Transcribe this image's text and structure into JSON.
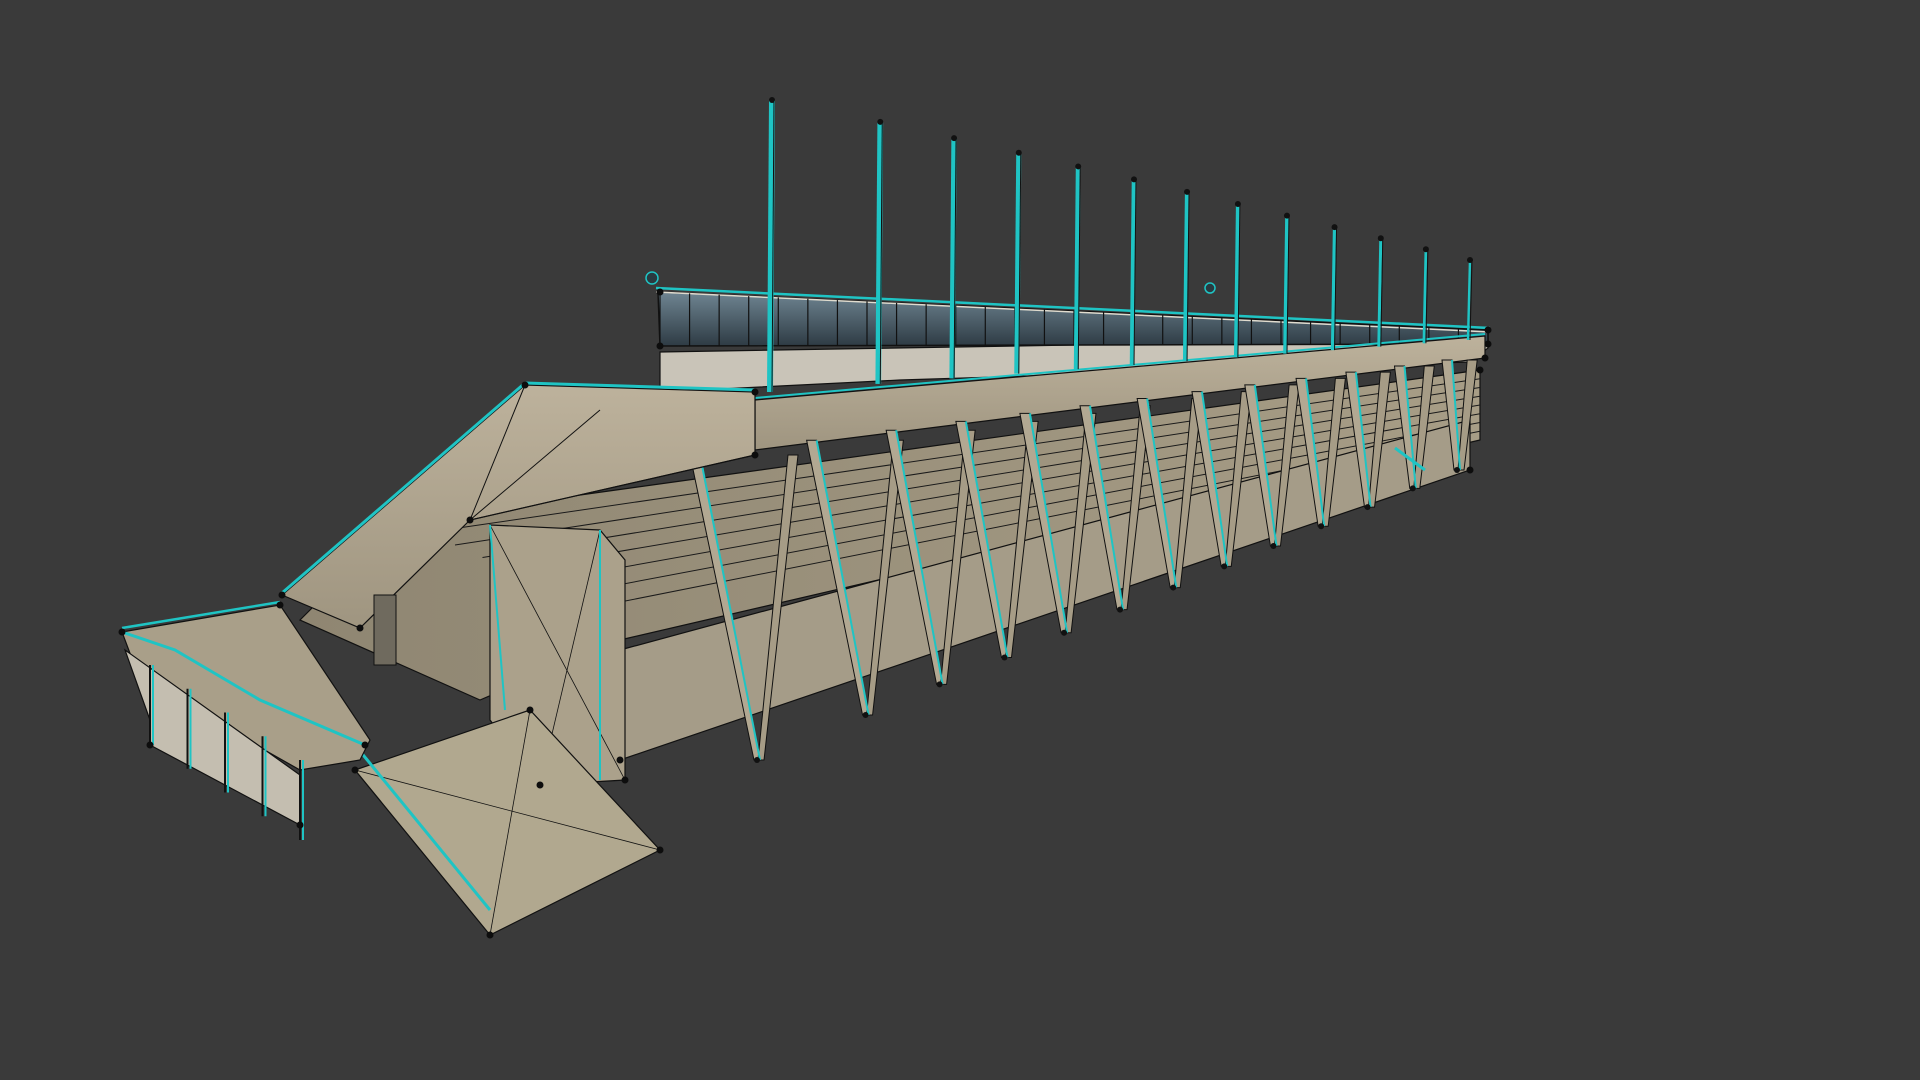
{
  "viewport": {
    "background": "#3a3a3a",
    "render_mode": "textured-wireframe",
    "selection_color": "#1fc4c4",
    "edge_color": "#0d0d0d",
    "concrete_color": "#b3a68f",
    "glass_color": "#4a5e6a"
  },
  "model": {
    "subject": "stadium-grandstand",
    "mast_count": 13
  }
}
